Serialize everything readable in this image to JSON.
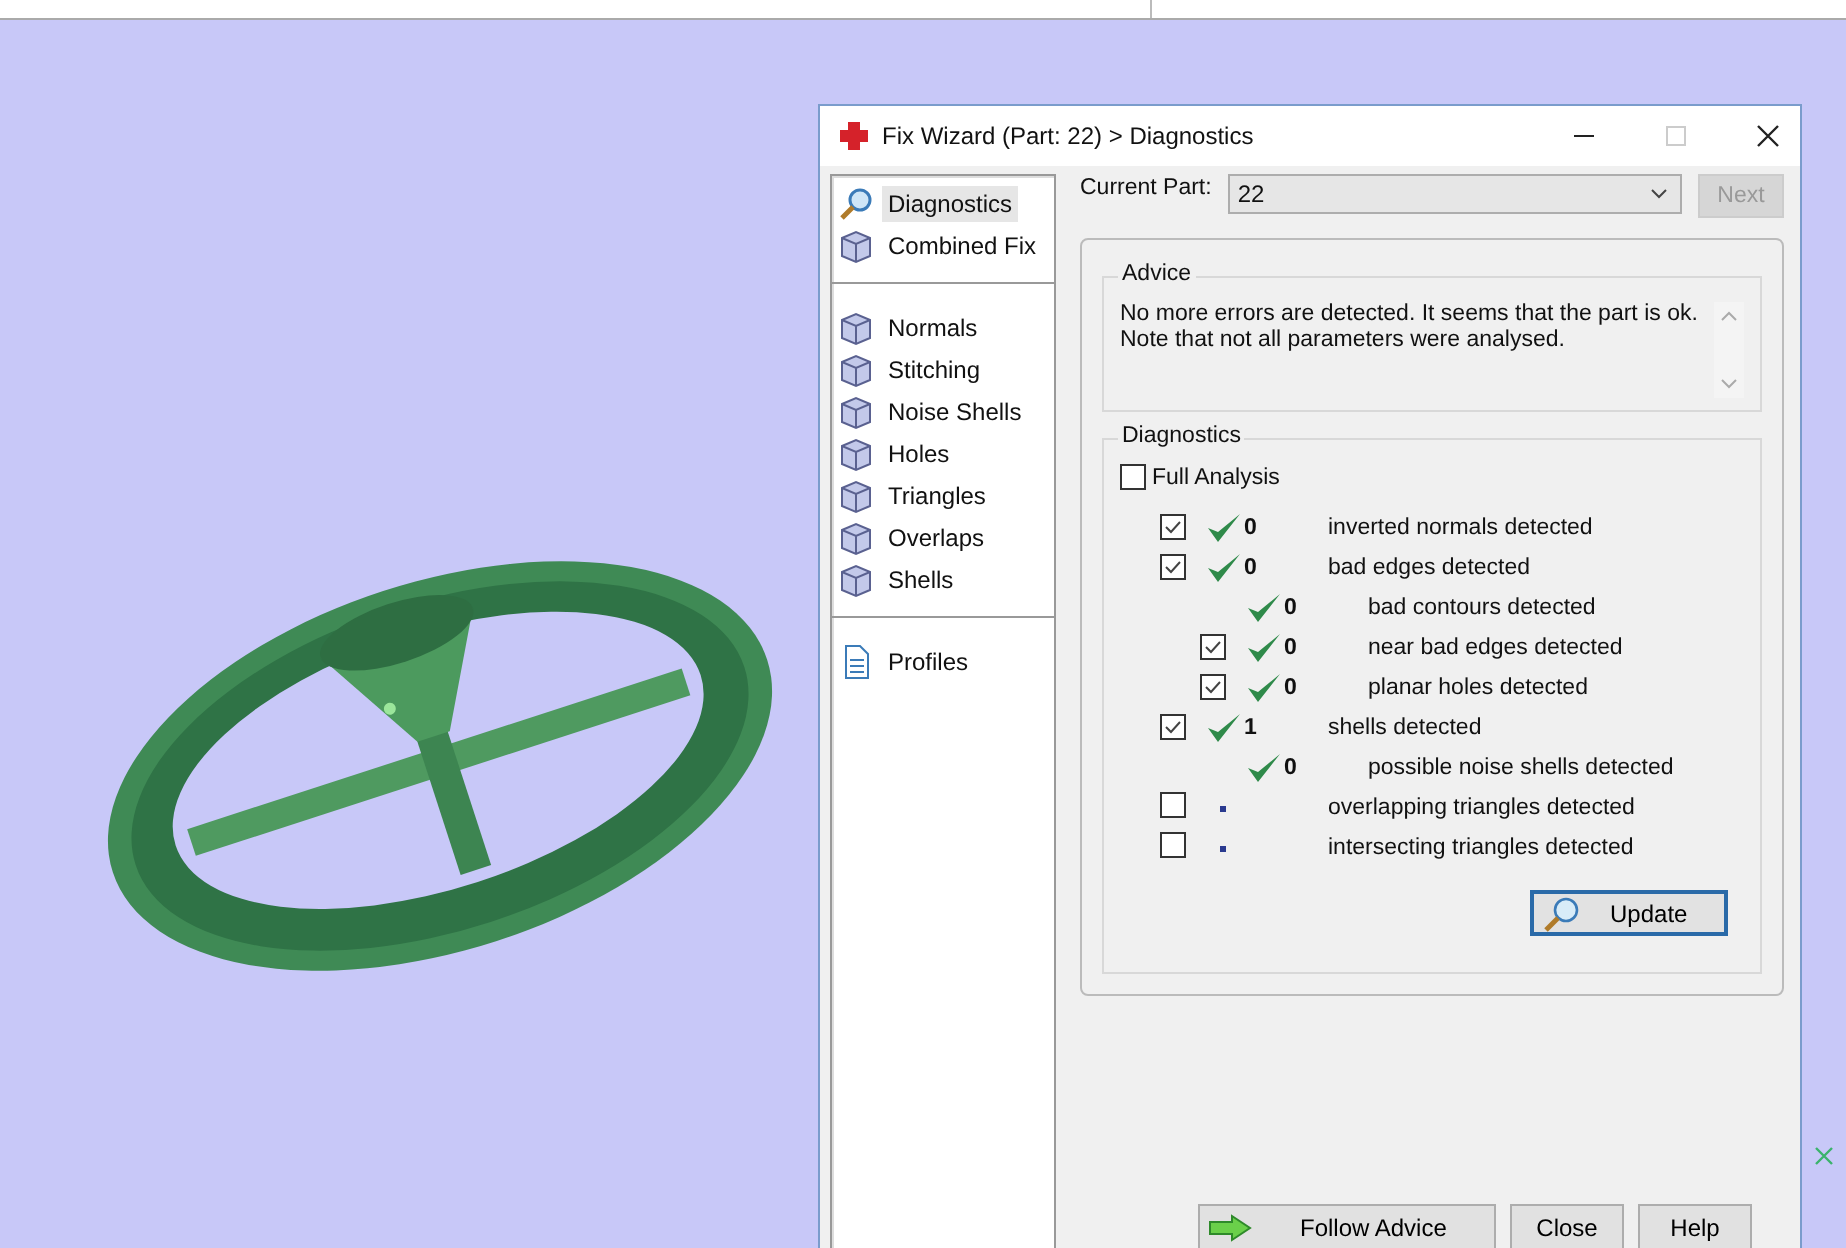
{
  "dialog": {
    "title": "Fix Wizard (Part: 22) > Diagnostics",
    "sidebar": {
      "groups": [
        [
          {
            "label": "Diagnostics",
            "kind": "magnifier",
            "selected": true
          },
          {
            "label": "Combined Fix",
            "kind": "cube",
            "selected": false
          }
        ],
        [
          {
            "label": "Normals",
            "kind": "cube",
            "selected": false
          },
          {
            "label": "Stitching",
            "kind": "cube",
            "selected": false
          },
          {
            "label": "Noise Shells",
            "kind": "cube",
            "selected": false
          },
          {
            "label": "Holes",
            "kind": "cube",
            "selected": false
          },
          {
            "label": "Triangles",
            "kind": "cube",
            "selected": false
          },
          {
            "label": "Overlaps",
            "kind": "cube",
            "selected": false
          },
          {
            "label": "Shells",
            "kind": "cube",
            "selected": false
          }
        ],
        [
          {
            "label": "Profiles",
            "kind": "document",
            "selected": false
          }
        ]
      ]
    },
    "current_part": {
      "label": "Current Part:",
      "value": "22"
    },
    "next_button": {
      "label": "Next",
      "disabled": true
    },
    "advice": {
      "title": "Advice",
      "lines": [
        "No more errors are detected. It seems that the part is ok.",
        "Note that not all parameters were analysed."
      ]
    },
    "diagnostics": {
      "title": "Diagnostics",
      "full_analysis": {
        "label": "Full Analysis",
        "checked": false
      },
      "rows": [
        {
          "kind": "check",
          "checked": true,
          "passed": true,
          "count": "0",
          "label": "inverted normals detected"
        },
        {
          "kind": "check",
          "checked": true,
          "passed": true,
          "count": "0",
          "label": "bad edges detected",
          "children": [
            {
              "kind": "plain",
              "passed": true,
              "count": "0",
              "label": "bad contours detected"
            },
            {
              "kind": "check",
              "checked": true,
              "passed": true,
              "count": "0",
              "label": "near bad edges detected"
            },
            {
              "kind": "check",
              "checked": true,
              "passed": true,
              "count": "0",
              "label": "planar holes detected"
            }
          ]
        },
        {
          "kind": "check",
          "checked": true,
          "passed": true,
          "count": "1",
          "label": "shells detected",
          "children": [
            {
              "kind": "plain",
              "passed": true,
              "count": "0",
              "label": "possible noise shells detected"
            }
          ]
        },
        {
          "kind": "check",
          "checked": false,
          "passed": false,
          "label": "overlapping triangles detected"
        },
        {
          "kind": "check",
          "checked": false,
          "passed": false,
          "label": "intersecting triangles detected"
        }
      ],
      "update_button": "Update"
    },
    "buttons": [
      {
        "label": "Follow Advice",
        "kind": "arrow"
      },
      {
        "label": "Close",
        "kind": "plain"
      },
      {
        "label": "Help",
        "kind": "plain"
      }
    ]
  }
}
